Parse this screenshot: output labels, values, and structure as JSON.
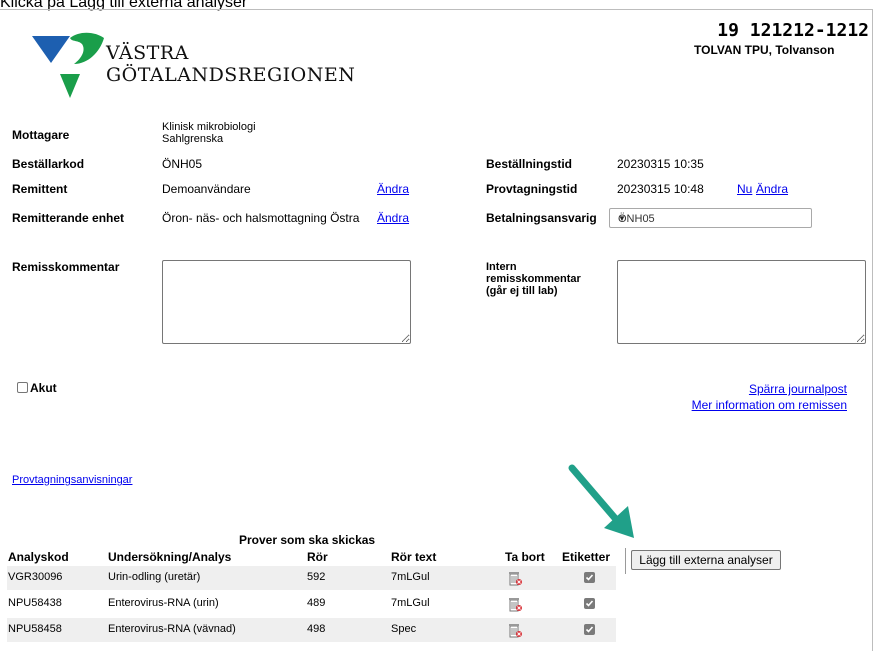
{
  "caption": "Klicka på Lägg till externa analyser",
  "logo": {
    "line1": "VÄSTRA",
    "line2": "GÖTALANDSREGIONEN"
  },
  "patient": {
    "id": "19 121212-1212",
    "name": "TOLVAN TPU, Tolvanson"
  },
  "fields": {
    "mottagare_label": "Mottagare",
    "mottagare_line1": "Klinisk mikrobiologi",
    "mottagare_line2": "Sahlgrenska",
    "bestallarkod_label": "Beställarkod",
    "bestallarkod_value": "ÖNH05",
    "remittent_label": "Remittent",
    "remittent_value": "Demoanvändare",
    "remittent_link": "Ändra",
    "remitterande_label": "Remitterande enhet",
    "remitterande_value": "Öron- näs- och halsmottagning Östra",
    "remitterande_link": "Ändra",
    "bestallningstid_label": "Beställningstid",
    "bestallningstid_value": "20230315 10:35",
    "provtagningstid_label": "Provtagningstid",
    "provtagningstid_value": "20230315 10:48",
    "provtagningstid_nu": "Nu",
    "provtagningstid_andra": "Ändra",
    "betalning_label": "Betalningsansvarig",
    "betalning_value": "ÖNH05",
    "remisskommentar_label": "Remisskommentar",
    "intern_line1": "Intern",
    "intern_line2": "remisskommentar",
    "intern_line3": "(går ej till lab)"
  },
  "akut_label": "Akut",
  "links": {
    "sparra": "Spärra journalpost",
    "mer_info": "Mer information om remissen",
    "provtagningsanvisningar": "Provtagningsanvisningar"
  },
  "button_add_external": "Lägg till externa analyser",
  "table": {
    "title": "Prover som ska skickas",
    "headers": [
      "Analyskod",
      "Undersökning/Analys",
      "Rör",
      "Rör text",
      "Ta bort",
      "Etiketter"
    ],
    "rows": [
      {
        "kod": "VGR30096",
        "analys": "Urin-odling (uretär)",
        "ror": "592",
        "rortext": "7mLGul",
        "etikett": true
      },
      {
        "kod": "NPU58438",
        "analys": "Enterovirus-RNA (urin)",
        "ror": "489",
        "rortext": "7mLGul",
        "etikett": true
      },
      {
        "kod": "NPU58458",
        "analys": "Enterovirus-RNA (vävnad)",
        "ror": "498",
        "rortext": "Spec",
        "etikett": true
      }
    ]
  },
  "colors": {
    "logo_blue": "#1d5fb0",
    "logo_green": "#1a9e4a",
    "arrow": "#20a089",
    "link": "#0000ee",
    "row_shade": "#efefef"
  },
  "icons": {
    "trash": "trash-icon",
    "checkbox": "checkbox-checked-icon",
    "arrow": "arrow-annotation-icon"
  }
}
